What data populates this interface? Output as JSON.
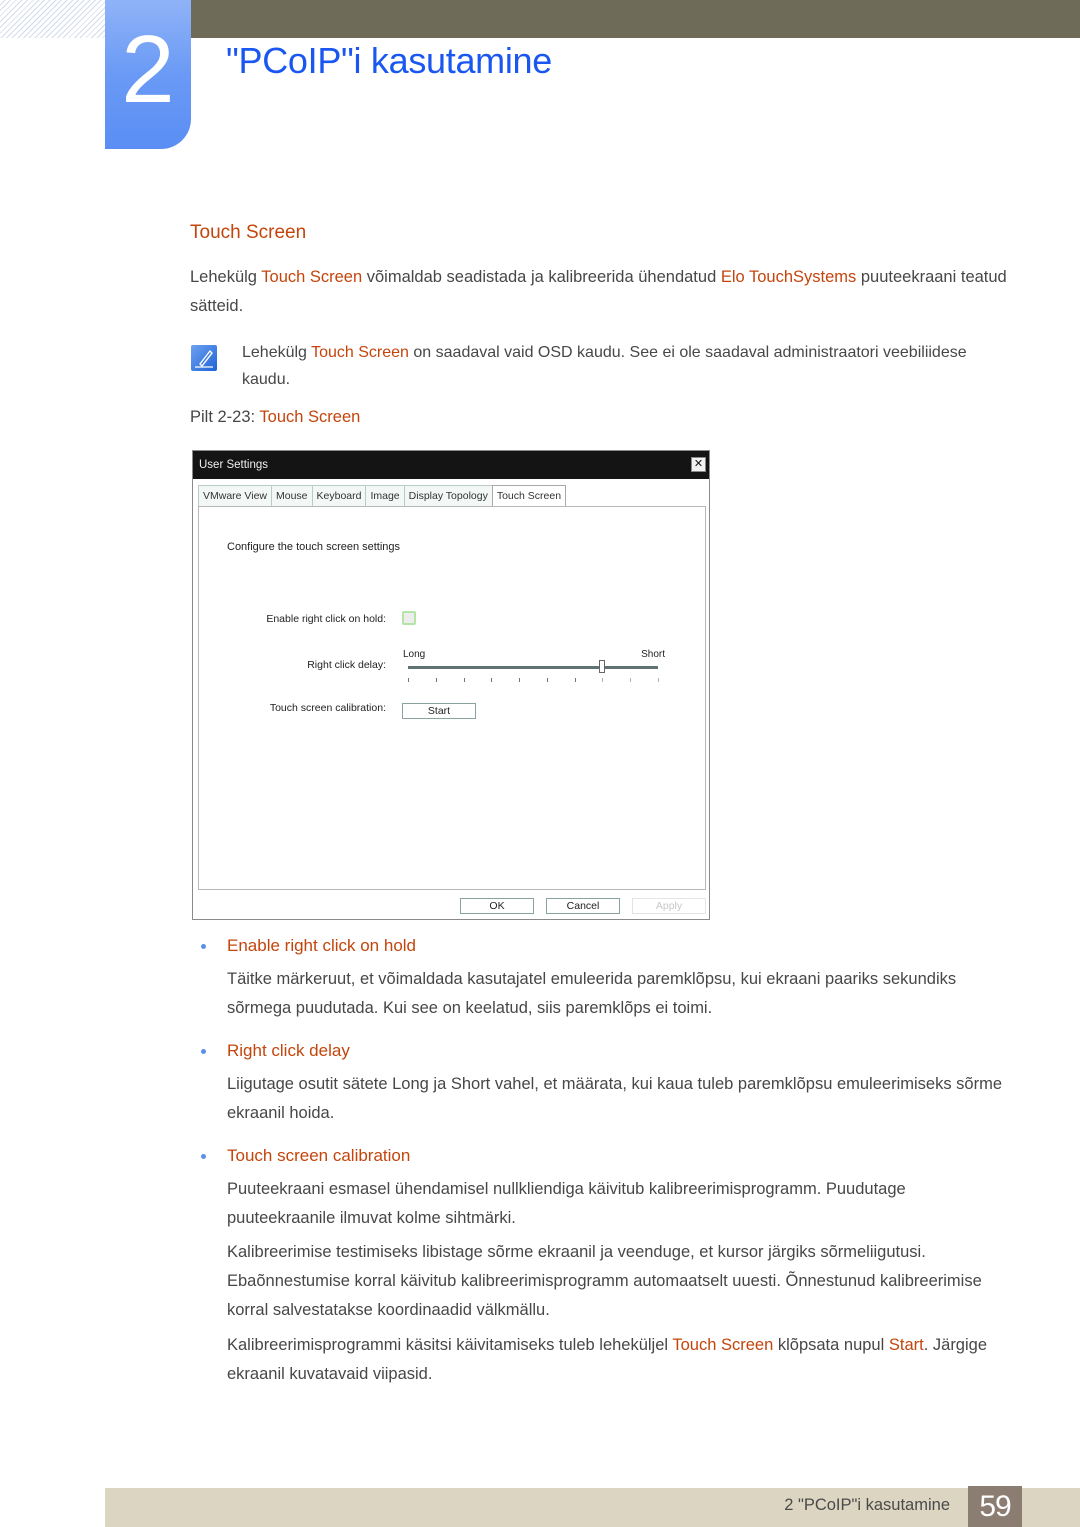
{
  "header": {
    "chapter_number": "2",
    "chapter_title": "\"PCoIP\"i kasutamine"
  },
  "section": {
    "title": "Touch Screen",
    "intro": [
      {
        "text": "Lehekülg ",
        "hl": false
      },
      {
        "text": "Touch Screen",
        "hl": true
      },
      {
        "text": " võimaldab seadistada ja kalibreerida ühendatud ",
        "hl": false
      },
      {
        "text": "Elo TouchSystems",
        "hl": true
      },
      {
        "text": " puuteekraani teatud sätteid.",
        "hl": false
      }
    ],
    "note": [
      {
        "text": "Lehekülg ",
        "hl": false
      },
      {
        "text": "Touch Screen",
        "hl": true
      },
      {
        "text": " on saadaval vaid OSD kaudu. See ei ole saadaval administraatori veebiliidese kaudu.",
        "hl": false
      }
    ],
    "figure_caption": {
      "prefix": "Pilt 2-23: ",
      "title": "Touch Screen"
    }
  },
  "dialog": {
    "title": "User Settings",
    "close_icon": "✕",
    "tabs": [
      {
        "label": "VMware View",
        "active": false
      },
      {
        "label": "Mouse",
        "active": false
      },
      {
        "label": "Keyboard",
        "active": false
      },
      {
        "label": "Image",
        "active": false
      },
      {
        "label": "Display Topology",
        "active": false
      },
      {
        "label": "Touch Screen",
        "active": true
      }
    ],
    "heading": "Configure the touch screen settings",
    "enable_right_click_label": "Enable right click on hold:",
    "enable_right_click_checked": false,
    "right_click_delay_label": "Right click delay:",
    "slider": {
      "min_label": "Long",
      "max_label": "Short",
      "tick_count": 10,
      "value_index": 7
    },
    "calibration_label": "Touch screen calibration:",
    "start_button": "Start",
    "ok_button": "OK",
    "cancel_button": "Cancel",
    "apply_button": "Apply"
  },
  "items": [
    {
      "title": "Enable right click on hold",
      "paragraphs": [
        [
          {
            "text": "Täitke märkeruut, et võimaldada kasutajatel emuleerida paremklõpsu, kui ekraani paariks sekundiks sõrmega puudutada. Kui see on keelatud, siis paremklõps ei toimi.",
            "hl": false
          }
        ]
      ]
    },
    {
      "title": "Right click delay",
      "paragraphs": [
        [
          {
            "text": "Liigutage osutit sätete Long ja Short vahel, et määrata, kui kaua tuleb paremklõpsu emuleerimiseks sõrme ekraanil hoida.",
            "hl": false
          }
        ]
      ]
    },
    {
      "title": "Touch screen calibration",
      "paragraphs": [
        [
          {
            "text": "Puuteekraani esmasel ühendamisel nullkliendiga käivitub kalibreerimisprogramm. Puudutage puuteekraanile ilmuvat kolme sihtmärki.",
            "hl": false
          }
        ],
        [
          {
            "text": "Kalibreerimise testimiseks libistage sõrme ekraanil ja veenduge, et kursor järgiks sõrmeliigutusi. Ebaõnnestumise korral käivitub kalibreerimisprogramm automaatselt uuesti. Õnnestunud kalibreerimise korral salvestatakse koordinaadid välkmällu.",
            "hl": false
          }
        ],
        [
          {
            "text": "Kalibreerimisprogrammi käsitsi käivitamiseks tuleb leheküljel ",
            "hl": false
          },
          {
            "text": "Touch Screen",
            "hl": true
          },
          {
            "text": " klõpsata nupul ",
            "hl": false
          },
          {
            "text": "Start",
            "hl": true
          },
          {
            "text": ". Järgige ekraanil kuvatavaid viipasid.",
            "hl": false
          }
        ]
      ]
    }
  ],
  "footer": {
    "chapter_label": "2 \"PCoIP\"i kasutamine",
    "page_number": "59"
  },
  "colors": {
    "accent_orange": "#c4450c",
    "chapter_blue": "#1a57f0",
    "topbar": "#6e6b58",
    "footer_bg": "#dcd5c2",
    "page_badge": "#8c7d72"
  }
}
